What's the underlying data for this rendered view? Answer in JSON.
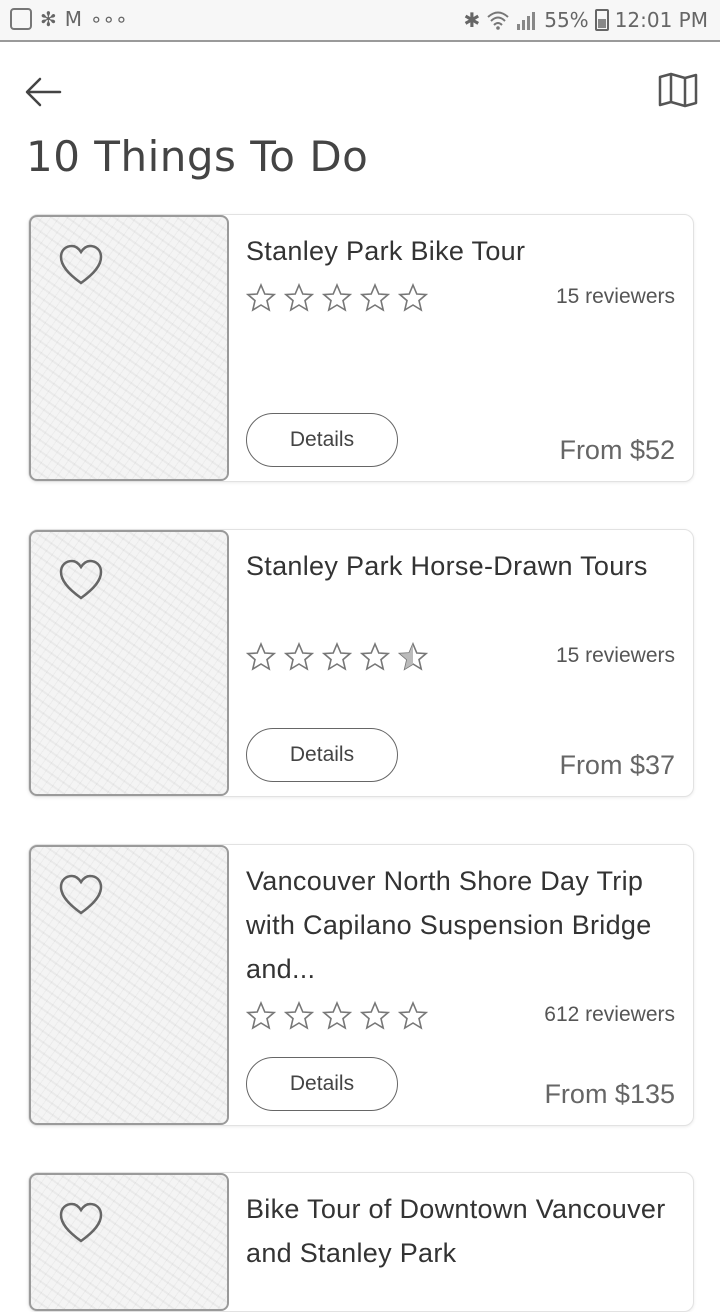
{
  "status_bar": {
    "battery": "55%",
    "time": "12:01 PM",
    "left_icons": [
      "image-icon",
      "fan-icon",
      "gmail-icon",
      "more-dots-icon"
    ],
    "right_icons": [
      "bluetooth-icon",
      "wifi-icon",
      "signal-icon",
      "battery-icon"
    ]
  },
  "header": {
    "back_icon": "back-arrow-icon",
    "map_icon": "map-icon",
    "title": "10 Things To Do"
  },
  "colors": {
    "text": "#333333",
    "border": "#9a9a9a",
    "muted": "#666666"
  },
  "cards": [
    {
      "title": "Stanley Park Bike Tour",
      "rating_stars": 5,
      "half_star": false,
      "reviews": "15 reviewers",
      "details_label": "Details",
      "price": "From $52"
    },
    {
      "title": "Stanley Park Horse-Drawn Tours",
      "rating_stars": 4.5,
      "half_star": true,
      "reviews": "15 reviewers",
      "details_label": "Details",
      "price": "From $37"
    },
    {
      "title": "Vancouver North Shore Day Trip with Capilano Suspension Bridge and...",
      "rating_stars": 5,
      "half_star": false,
      "reviews": "612 reviewers",
      "details_label": "Details",
      "price": "From $135"
    },
    {
      "title": "Bike Tour of Downtown Vancouver and Stanley Park"
    }
  ]
}
